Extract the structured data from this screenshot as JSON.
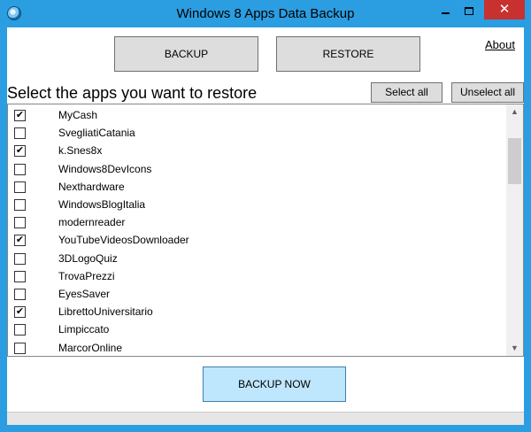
{
  "window": {
    "title": "Windows 8 Apps Data Backup",
    "close_glyph": "✕",
    "icon": "app-globe-icon"
  },
  "toolbar": {
    "backup_label": "BACKUP",
    "restore_label": "RESTORE",
    "about_label": "About"
  },
  "restore": {
    "label": "Select the apps you want to restore",
    "select_all_label": "Select all",
    "unselect_all_label": "Unselect all"
  },
  "apps": [
    {
      "name": "MyCash",
      "checked": true
    },
    {
      "name": "SvegliatiCatania",
      "checked": false
    },
    {
      "name": "k.Snes8x",
      "checked": true
    },
    {
      "name": "Windows8DevIcons",
      "checked": false
    },
    {
      "name": "Nexthardware",
      "checked": false
    },
    {
      "name": "WindowsBlogItalia",
      "checked": false
    },
    {
      "name": "modernreader",
      "checked": false
    },
    {
      "name": "YouTubeVideosDownloader",
      "checked": true
    },
    {
      "name": "3DLogoQuiz",
      "checked": false
    },
    {
      "name": "TrovaPrezzi",
      "checked": false
    },
    {
      "name": "EyesSaver",
      "checked": false
    },
    {
      "name": "LibrettoUniversitario",
      "checked": true
    },
    {
      "name": "Limpiccato",
      "checked": false
    },
    {
      "name": "MarcorOnline",
      "checked": false
    }
  ],
  "footer": {
    "backup_now_label": "BACKUP NOW"
  },
  "colors": {
    "titlebar": "#2b9de1",
    "close": "#c7312f",
    "primary_button": "#bee6fd"
  }
}
